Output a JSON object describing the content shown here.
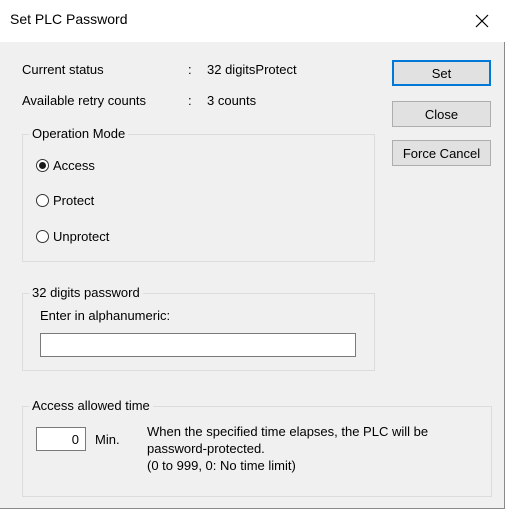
{
  "window": {
    "title": "Set PLC Password",
    "close_glyph": "✕"
  },
  "status": {
    "current_label": "Current status",
    "current_sep": ":",
    "current_value": "32 digitsProtect",
    "retry_label": "Available retry counts",
    "retry_sep": ":",
    "retry_value": "3 counts"
  },
  "buttons": {
    "set": "Set",
    "close": "Close",
    "force_cancel": "Force Cancel"
  },
  "operation_mode": {
    "title": "Operation Mode",
    "options": [
      {
        "label": "Access",
        "checked": true
      },
      {
        "label": "Protect",
        "checked": false
      },
      {
        "label": "Unprotect",
        "checked": false
      }
    ]
  },
  "password": {
    "group_title": "32 digits password",
    "prompt": "Enter in alphanumeric:",
    "value": ""
  },
  "access_time": {
    "group_title": "Access allowed time",
    "minutes_value": "0",
    "unit": "Min.",
    "desc_line1": "When the specified time elapses, the PLC will be",
    "desc_line2": "password-protected.",
    "desc_line3": "(0 to 999, 0: No time limit)"
  }
}
